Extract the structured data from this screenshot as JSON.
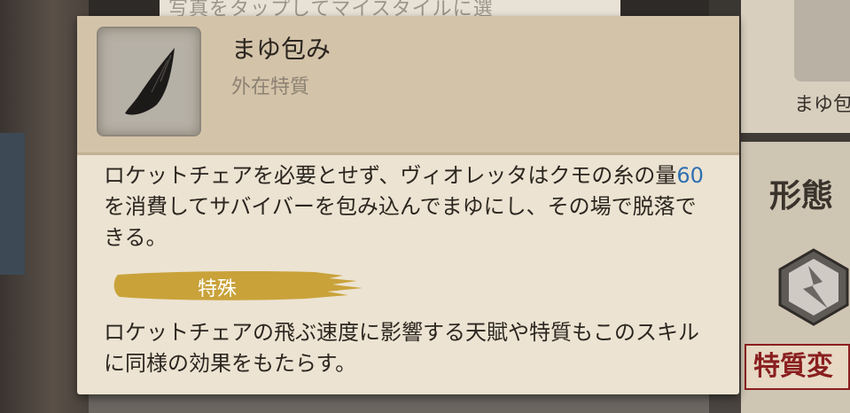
{
  "background": {
    "top_card_text": "写真をタップしてマイスタイルに選",
    "right_label": "まゆ包",
    "form_label": "形態",
    "change_button": "特質変"
  },
  "trait": {
    "icon": "cocoon-blade-icon",
    "name": "まゆ包み",
    "category": "外在特質",
    "description_pre": "ロケットチェアを必要とせず、ヴィオレッタはクモの糸の量",
    "description_value": "60",
    "description_post": "を消費してサバイバーを包み込んでまゆにし、その場で脱落できる。",
    "special_label": "特殊",
    "special_description": "ロケットチェアの飛ぶ速度に影響する天賦や特質もこのスキルに同様の効果をもたらす。"
  },
  "colors": {
    "panel_bg": "#ece3d2",
    "header_bg": "#d3c3a9",
    "highlight": "#2f6fb1",
    "special_banner": "#c9a23a"
  }
}
